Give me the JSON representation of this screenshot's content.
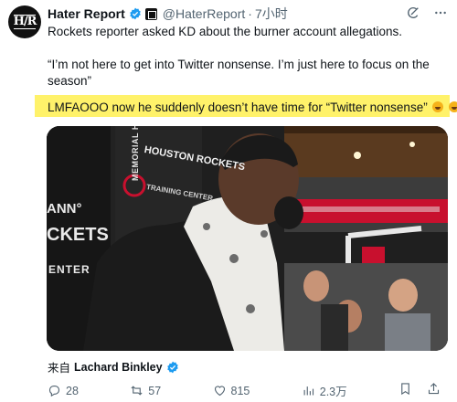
{
  "account": {
    "avatar_text": "H/R",
    "name": "Hater Report",
    "handle": "@HaterReport",
    "separator": "·",
    "time": "7小时"
  },
  "tweet": {
    "line1": "Rockets reporter asked KD about the burner account allegations.",
    "quote_line1": "“I’m not here to get into Twitter nonsense. I’m just here to focus on the",
    "quote_line2": "season”",
    "highlight_line": "LMFAOOO now he suddenly doesn’t have time for “Twitter nonsense”",
    "highlight_color": "#fff26a"
  },
  "media": {
    "banner_text1": "MEMORIAL HERMANN",
    "banner_text2": "HOUSTON ROCKETS",
    "banner_text3": "TRAINING CENTER",
    "wall_text1": "ANN°",
    "wall_text2": "CKETS",
    "wall_text3": "ENTER",
    "accent_red": "#c8102e"
  },
  "source": {
    "prefix": "来自",
    "name": "Lachard Binkley"
  },
  "actions": {
    "replies": "28",
    "retweets": "57",
    "likes": "815",
    "views": "2.3万"
  },
  "icons": [
    "verified-badge-icon",
    "affiliate-badge-icon",
    "grok-icon",
    "more-icon",
    "reply-icon",
    "retweet-icon",
    "like-icon",
    "views-icon",
    "bookmark-icon",
    "share-icon"
  ],
  "colors": {
    "verified_blue": "#1d9bf0",
    "muted": "#536471",
    "text": "#0f1419"
  }
}
